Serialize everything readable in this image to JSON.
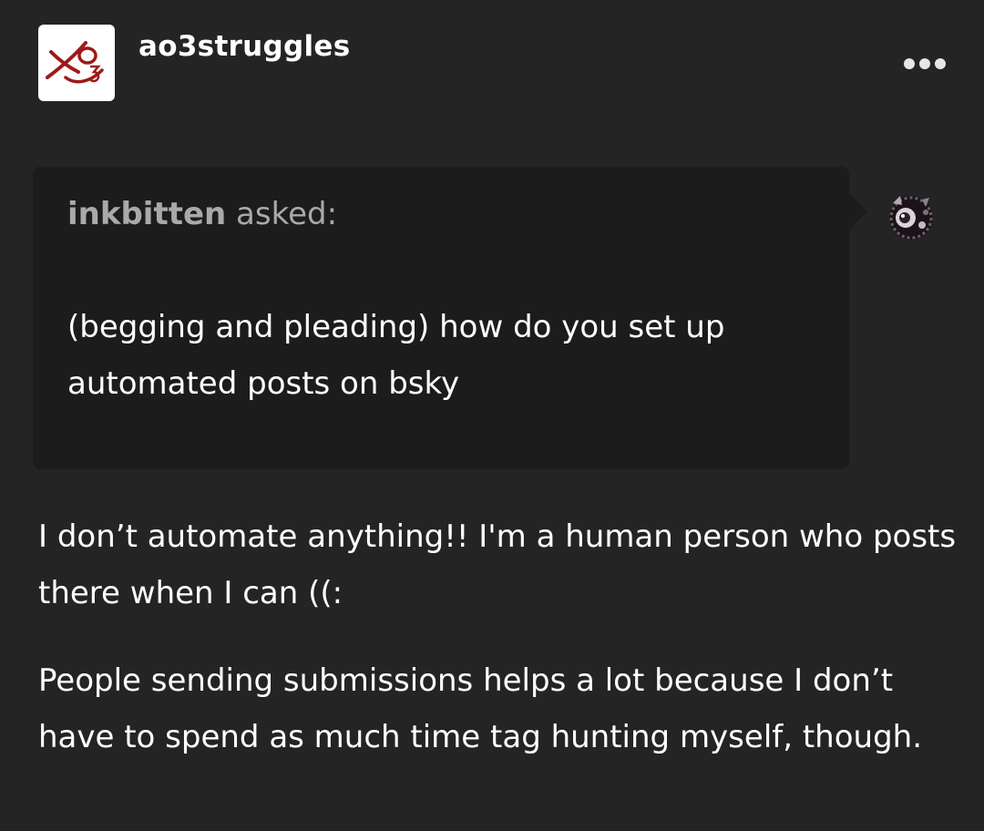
{
  "post": {
    "username": "ao3struggles",
    "avatar_icon": "ao3-logo-icon",
    "more_icon": "more-options-icon",
    "ask": {
      "asker": "inkbitten",
      "asked_label": "asked:",
      "question": "(begging and pleading) how do you set up automated posts on bsky",
      "asker_avatar_icon": "asker-avatar-icon"
    },
    "answer": {
      "paragraphs": [
        "I don’t automate anything!! I'm a human person who posts there when I can ((:",
        "People sending submissions helps a lot because I don’t have to spend as much time tag hunting myself, though."
      ]
    }
  }
}
